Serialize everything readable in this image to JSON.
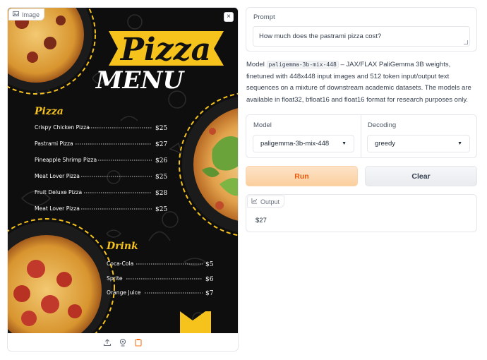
{
  "image_panel": {
    "label": "Image",
    "close_glyph": "×",
    "label_icon": "image-icon",
    "toolbar_icons": [
      "upload-icon",
      "webcam-icon",
      "clipboard-icon"
    ]
  },
  "menu": {
    "title_top": "Pizza",
    "title_bottom": "MENU",
    "pizza_heading": "Pizza",
    "pizza_items": [
      {
        "name": "Crispy Chicken Pizza",
        "price": "$25"
      },
      {
        "name": "Pastrami Pizza",
        "price": "$27"
      },
      {
        "name": "Pineapple Shrimp Pizza",
        "price": "$26"
      },
      {
        "name": "Meat Lover Pizza",
        "price": "$25"
      },
      {
        "name": "Fruit Deluxe Pizza",
        "price": "$28"
      },
      {
        "name": "Meat Lover Pizza",
        "price": "$25"
      }
    ],
    "drink_heading": "Drink",
    "drink_items": [
      {
        "name": "Coca-Cola",
        "price": "$5"
      },
      {
        "name": "Sprite",
        "price": "$6"
      },
      {
        "name": "Orange Juice",
        "price": "$7"
      }
    ]
  },
  "prompt": {
    "label": "Prompt",
    "value": "How much does the pastrami pizza cost?"
  },
  "description": {
    "prefix": "Model ",
    "model_code": "paligemma-3b-mix-448",
    "suffix": " – JAX/FLAX PaliGemma 3B weights, finetuned with 448x448 input images and 512 token input/output text sequences on a mixture of downstream academic datasets. The models are available in float32, bfloat16 and float16 format for research purposes only."
  },
  "options": {
    "model_label": "Model",
    "model_value": "paligemma-3b-mix-448",
    "decoding_label": "Decoding",
    "decoding_value": "greedy"
  },
  "buttons": {
    "run": "Run",
    "clear": "Clear"
  },
  "output": {
    "label": "Output",
    "value": "$27",
    "label_icon": "chart-icon"
  },
  "colors": {
    "menu_yellow": "#f6c21c",
    "menu_background": "#0e0e0e",
    "run_text": "#ea580c",
    "run_bg": "#fbcf9e"
  }
}
